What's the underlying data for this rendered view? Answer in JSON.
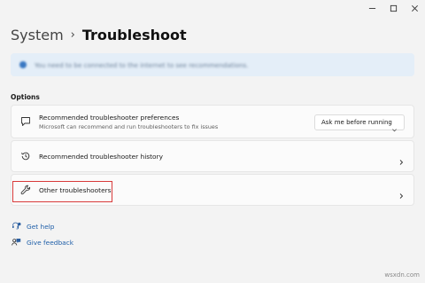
{
  "window": {
    "controls": [
      "minimize-icon",
      "maximize-icon",
      "close-icon"
    ]
  },
  "breadcrumb": {
    "parent": "System",
    "separator": "›",
    "current": "Troubleshoot"
  },
  "notice": {
    "icon": "info-icon",
    "text": "You need to be connected to the internet to see recommendations."
  },
  "options": {
    "section_label": "Options",
    "cards": [
      {
        "icon": "chat-message-icon",
        "title": "Recommended troubleshooter preferences",
        "subtitle": "Microsoft can recommend and run troubleshooters to fix issues",
        "dropdown": {
          "selected": "Ask me before running",
          "icon": "chevron-down-icon"
        }
      },
      {
        "icon": "history-icon",
        "title": "Recommended troubleshooter history",
        "chevron": "chevron-right-icon"
      },
      {
        "icon": "wrench-icon",
        "title": "Other troubleshooters",
        "chevron": "chevron-right-icon",
        "highlighted": true,
        "highlight_color": "#d83a3a"
      }
    ]
  },
  "links": [
    {
      "icon": "help-icon",
      "label": "Get help"
    },
    {
      "icon": "feedback-icon",
      "label": "Give feedback"
    }
  ],
  "watermark": "wsxdn.com",
  "colors": {
    "background": "#f3f3f3",
    "card": "#fbfbfb",
    "link": "#1f5fa8",
    "highlight": "#d83a3a",
    "notice_bg": "#e4eef8"
  }
}
